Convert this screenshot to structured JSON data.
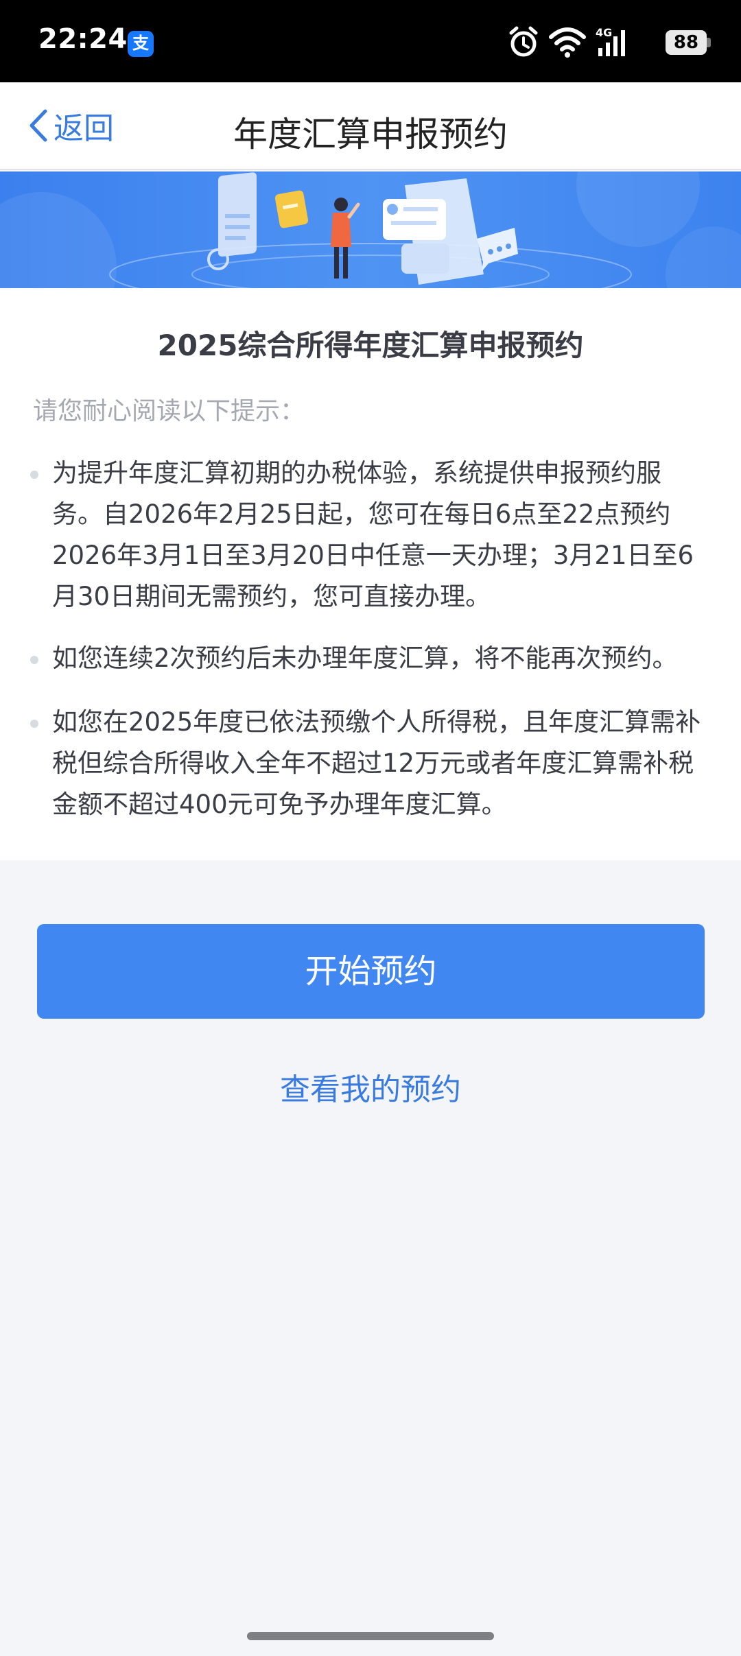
{
  "status_bar": {
    "time": "22:24",
    "app_badge": "支",
    "network": "4G",
    "battery": "88"
  },
  "nav": {
    "back_label": "返回",
    "title": "年度汇算申报预约"
  },
  "content": {
    "title": "2025综合所得年度汇算申报预约",
    "hint": "请您耐心阅读以下提示：",
    "bullets": [
      "为提升年度汇算初期的办税体验，系统提供申报预约服务。自2026年2月25日起，您可在每日6点至22点预约2026年3月1日至3月20日中任意一天办理；3月21日至6月30日期间无需预约，您可直接办理。",
      "如您连续2次预约后未办理年度汇算，将不能再次预约。",
      "如您在2025年度已依法预缴个人所得税，且年度汇算需补税但综合所得收入全年不超过12万元或者年度汇算需补税金额不超过400元可免予办理年度汇算。"
    ]
  },
  "actions": {
    "start_label": "开始预约",
    "view_label": "查看我的预约"
  },
  "colors": {
    "primary": "#4087f2",
    "link": "#3a7be0",
    "banner": "#4a8ff2"
  }
}
